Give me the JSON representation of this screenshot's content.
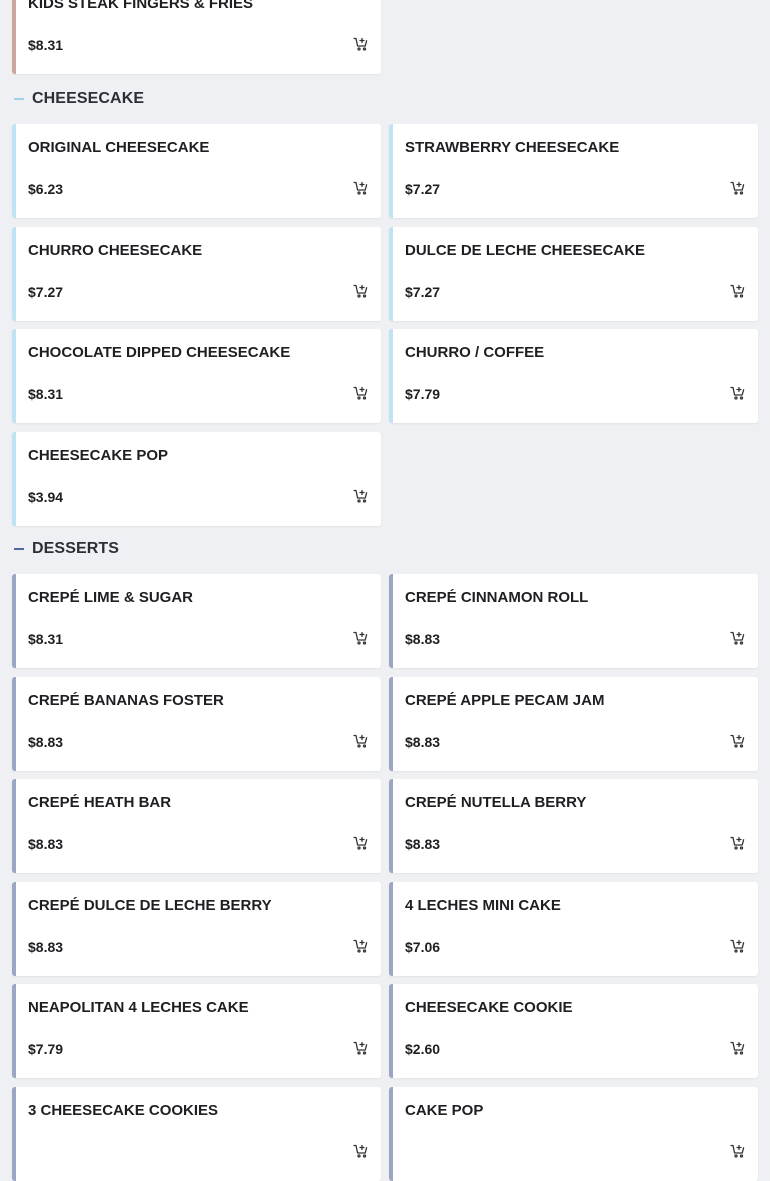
{
  "colors": {
    "background": "#eef0f3",
    "card": "#ffffff",
    "cheesecake_accent": "#bfe3f2",
    "cheesecake_dash": "#9fd2ea",
    "desserts_accent": "#9aa6c3",
    "desserts_dash": "#4e6aa0",
    "kids_accent": "#c9a79e"
  },
  "top_item": {
    "name": "KIDS STEAK FINGERS & FRIES",
    "price": "$8.31"
  },
  "sections": [
    {
      "title": "CHEESECAKE",
      "items": [
        {
          "name": "ORIGINAL CHEESECAKE",
          "price": "$6.23"
        },
        {
          "name": "STRAWBERRY CHEESECAKE",
          "price": "$7.27"
        },
        {
          "name": "CHURRO CHEESECAKE",
          "price": "$7.27"
        },
        {
          "name": "DULCE DE LECHE CHEESECAKE",
          "price": "$7.27"
        },
        {
          "name": "CHOCOLATE DIPPED CHEESECAKE",
          "price": "$8.31"
        },
        {
          "name": "CHURRO / COFFEE",
          "price": "$7.79"
        },
        {
          "name": "CHEESECAKE POP",
          "price": "$3.94"
        }
      ]
    },
    {
      "title": "DESSERTS",
      "items": [
        {
          "name": "CREPÉ LIME & SUGAR",
          "price": "$8.31"
        },
        {
          "name": "CREPÉ CINNAMON ROLL",
          "price": "$8.83"
        },
        {
          "name": "CREPÉ BANANAS FOSTER",
          "price": "$8.83"
        },
        {
          "name": "CREPÉ APPLE PECAM JAM",
          "price": "$8.83"
        },
        {
          "name": "CREPÉ HEATH BAR",
          "price": "$8.83"
        },
        {
          "name": "CREPÉ NUTELLA BERRY",
          "price": "$8.83"
        },
        {
          "name": "CREPÉ DULCE DE LECHE BERRY",
          "price": "$8.83"
        },
        {
          "name": "4 LECHES MINI CAKE",
          "price": "$7.06"
        },
        {
          "name": "NEAPOLITAN 4 LECHES CAKE",
          "price": "$7.79"
        },
        {
          "name": "CHEESECAKE COOKIE",
          "price": "$2.60"
        },
        {
          "name": "3 CHEESECAKE COOKIES",
          "price": ""
        },
        {
          "name": "CAKE POP",
          "price": ""
        }
      ]
    }
  ],
  "icons": {
    "add_to_cart": "add-to-cart-icon"
  }
}
